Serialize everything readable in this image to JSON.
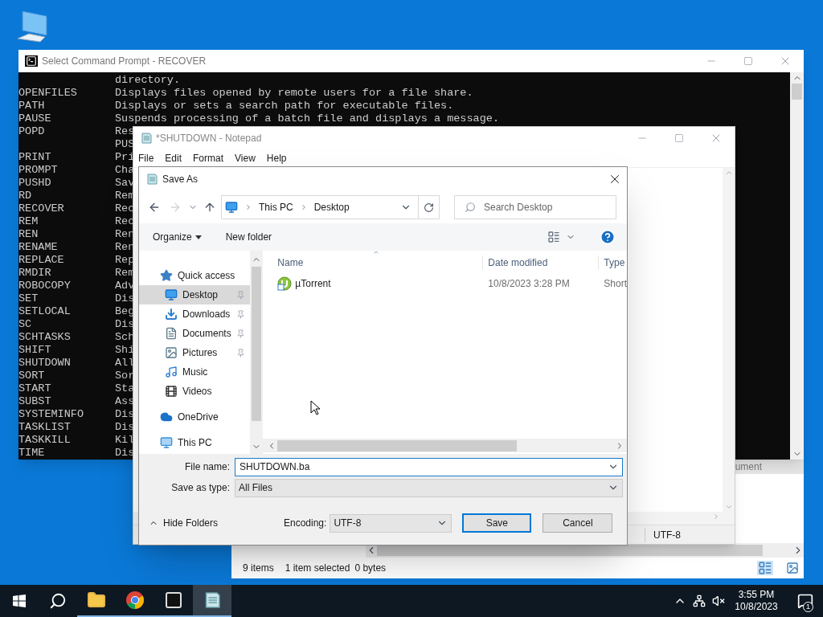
{
  "command_prompt": {
    "title": "Select Command Prompt - RECOVER",
    "lines": [
      {
        "description": "directory."
      },
      {
        "command": "OPENFILES",
        "description": "Displays files opened by remote users for a file share."
      },
      {
        "command": "PATH",
        "description": "Displays or sets a search path for executable files."
      },
      {
        "command": "PAUSE",
        "description": "Suspends processing of a batch file and displays a message."
      },
      {
        "command": "POPD",
        "description": "Res"
      },
      {
        "description": "PUS"
      },
      {
        "command": "PRINT",
        "description": "Pri"
      },
      {
        "command": "PROMPT",
        "description": "Cha"
      },
      {
        "command": "PUSHD",
        "description": "Sav"
      },
      {
        "command": "RD",
        "description": "Rem"
      },
      {
        "command": "RECOVER",
        "description": "Rec"
      },
      {
        "command": "REM",
        "description": "Rec"
      },
      {
        "command": "REN",
        "description": "Ren"
      },
      {
        "command": "RENAME",
        "description": "Ren"
      },
      {
        "command": "REPLACE",
        "description": "Rep"
      },
      {
        "command": "RMDIR",
        "description": "Rem"
      },
      {
        "command": "ROBOCOPY",
        "description": "Adv"
      },
      {
        "command": "SET",
        "description": "Dis"
      },
      {
        "command": "SETLOCAL",
        "description": "Beg"
      },
      {
        "command": "SC",
        "description": "Dis"
      },
      {
        "command": "SCHTASKS",
        "description": "Sch"
      },
      {
        "command": "SHIFT",
        "description": "Shi"
      },
      {
        "command": "SHUTDOWN",
        "description": "All"
      },
      {
        "command": "SORT",
        "description": "Sor"
      },
      {
        "command": "START",
        "description": "Sta"
      },
      {
        "command": "SUBST",
        "description": "Ass"
      },
      {
        "command": "SYSTEMINFO",
        "description": "Dis"
      },
      {
        "command": "TASKLIST",
        "description": "Dis"
      },
      {
        "command": "TASKKILL",
        "description": "Kil"
      },
      {
        "command": "TIME",
        "description": "Dis"
      }
    ]
  },
  "explorer_behind": {
    "column_header": "ument",
    "status": [
      "9 items",
      "1 item selected",
      "0 bytes"
    ]
  },
  "notepad": {
    "title": "*SHUTDOWN - Notepad",
    "menu": [
      "File",
      "Edit",
      "Format",
      "View",
      "Help"
    ],
    "encoding": "UTF-8"
  },
  "save_as": {
    "title": "Save As",
    "breadcrumb": [
      "This PC",
      "Desktop"
    ],
    "search_placeholder": "Search Desktop",
    "organize": "Organize",
    "new_folder": "New folder",
    "nav": [
      {
        "label": "Quick access",
        "kind": "star",
        "children": [
          {
            "label": "Desktop",
            "kind": "desktop",
            "pinned": true,
            "selected": true
          },
          {
            "label": "Downloads",
            "kind": "downloads",
            "pinned": true,
            "selected": false
          },
          {
            "label": "Documents",
            "kind": "documents",
            "pinned": true,
            "selected": false
          },
          {
            "label": "Pictures",
            "kind": "pictures",
            "pinned": true,
            "selected": false
          },
          {
            "label": "Music",
            "kind": "music",
            "pinned": false,
            "selected": false
          },
          {
            "label": "Videos",
            "kind": "videos",
            "pinned": false,
            "selected": false
          }
        ]
      },
      {
        "label": "OneDrive",
        "kind": "cloud"
      },
      {
        "label": "This PC",
        "kind": "pc"
      }
    ],
    "columns": [
      "Name",
      "Date modified",
      "Type"
    ],
    "files": [
      {
        "name": "µTorrent",
        "date_modified": "10/8/2023 3:28 PM",
        "type": "Short"
      }
    ],
    "file_name_label": "File name:",
    "file_name": "SHUTDOWN.ba",
    "save_type_label": "Save as type:",
    "save_type": "All Files",
    "hide_folders": "Hide Folders",
    "encoding_label": "Encoding:",
    "encoding": "UTF-8",
    "save": "Save",
    "cancel": "Cancel"
  },
  "taskbar": {
    "apps": [
      {
        "kind": "explorer",
        "active": false
      },
      {
        "kind": "chrome",
        "active": false
      },
      {
        "kind": "terminal",
        "active": false
      },
      {
        "kind": "notepad",
        "active": true
      }
    ],
    "time": "3:55 PM",
    "date": "10/8/2023",
    "notifications": "1"
  }
}
